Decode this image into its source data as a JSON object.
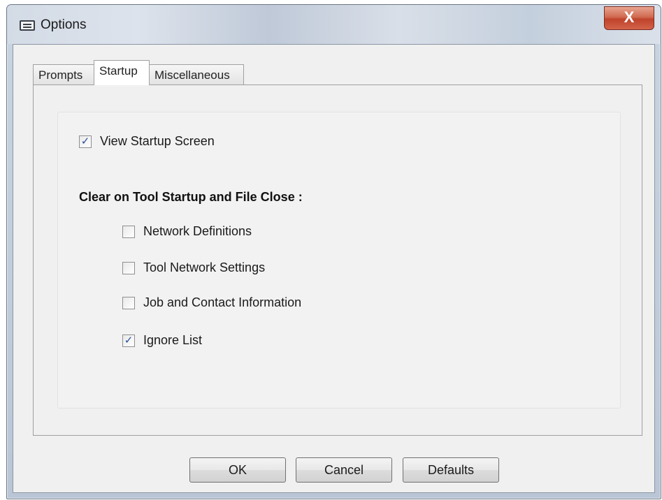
{
  "window": {
    "title": "Options",
    "close_symbol": "X"
  },
  "tabs": [
    {
      "label": "Prompts",
      "active": false
    },
    {
      "label": "Startup",
      "active": true
    },
    {
      "label": "Miscellaneous",
      "active": false
    }
  ],
  "startup": {
    "view_startup_screen": {
      "label": "View Startup Screen",
      "checked": true
    },
    "clear_heading": "Clear on Tool Startup and File Close :",
    "clear_options": [
      {
        "label": "Network Definitions",
        "checked": false
      },
      {
        "label": "Tool Network Settings",
        "checked": false
      },
      {
        "label": "Job and Contact Information",
        "checked": false
      },
      {
        "label": "Ignore List",
        "checked": true
      }
    ]
  },
  "buttons": {
    "ok": "OK",
    "cancel": "Cancel",
    "defaults": "Defaults"
  },
  "icons": {
    "window_icon": "window-icon",
    "check_mark": "✓"
  }
}
